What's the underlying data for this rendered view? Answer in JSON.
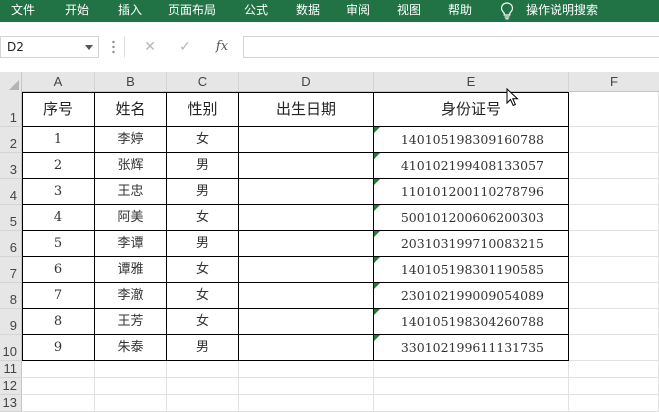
{
  "ribbon": {
    "tabs": [
      "文件",
      "开始",
      "插入",
      "页面布局",
      "公式",
      "数据",
      "审阅",
      "视图",
      "帮助"
    ],
    "tell_me": "操作说明搜索"
  },
  "formula_bar": {
    "name_box": "D2",
    "cancel_icon": "✕",
    "enter_icon": "✓",
    "fx_label": "fx",
    "formula": ""
  },
  "columns": [
    "A",
    "B",
    "C",
    "D",
    "E",
    "F"
  ],
  "rows": [
    "1",
    "2",
    "3",
    "4",
    "5",
    "6",
    "7",
    "8",
    "9",
    "10",
    "11",
    "12",
    "13"
  ],
  "table": {
    "headers": [
      "序号",
      "姓名",
      "性别",
      "出生日期",
      "身份证号"
    ],
    "rows": [
      [
        "1",
        "李婷",
        "女",
        "",
        "140105198309160788"
      ],
      [
        "2",
        "张辉",
        "男",
        "",
        "410102199408133057"
      ],
      [
        "3",
        "王忠",
        "男",
        "",
        "110101200110278796"
      ],
      [
        "4",
        "阿美",
        "女",
        "",
        "500101200606200303"
      ],
      [
        "5",
        "李谭",
        "男",
        "",
        "203103199710083215"
      ],
      [
        "6",
        "谭雅",
        "女",
        "",
        "140105198301190585"
      ],
      [
        "7",
        "李澈",
        "女",
        "",
        "230102199009054089"
      ],
      [
        "8",
        "王芳",
        "女",
        "",
        "140105198304260788"
      ],
      [
        "9",
        "朱泰",
        "男",
        "",
        "330102199611131735"
      ]
    ]
  },
  "colors": {
    "ribbon": "#217346",
    "number_marker": "#1e7e34"
  },
  "icons": {
    "tell_me": "lightbulb-icon",
    "name_box_dropdown": "chevron-down-icon"
  }
}
